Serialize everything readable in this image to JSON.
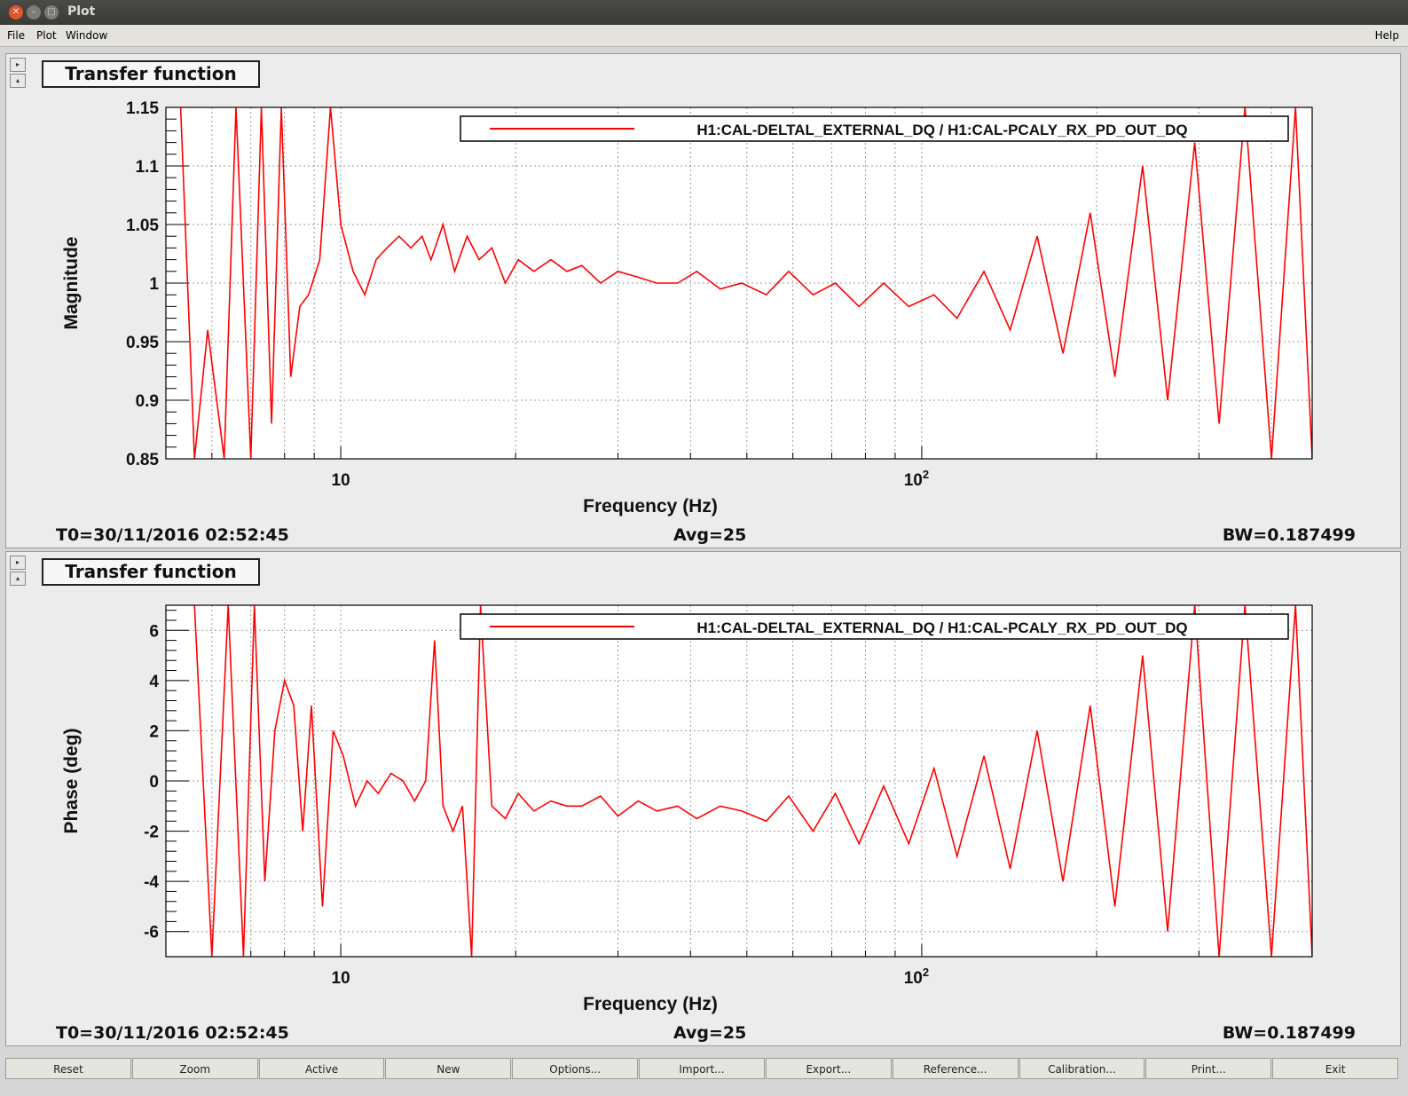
{
  "window": {
    "title": "Plot"
  },
  "menu": {
    "file": "File",
    "plot": "Plot",
    "window": "Window",
    "help": "Help"
  },
  "pads": [
    {
      "box_title": "Transfer function",
      "info": {
        "t0": "T0=30/11/2016 02:52:45",
        "avg": "Avg=25",
        "bw": "BW=0.187499"
      }
    },
    {
      "box_title": "Transfer function",
      "info": {
        "t0": "T0=30/11/2016 02:52:45",
        "avg": "Avg=25",
        "bw": "BW=0.187499"
      }
    }
  ],
  "toolbar": [
    "Reset",
    "Zoom",
    "Active",
    "New",
    "Options...",
    "Import...",
    "Export...",
    "Reference...",
    "Calibration...",
    "Print...",
    "Exit"
  ],
  "colors": {
    "trace": "#ff0000",
    "grid": "#999999"
  },
  "chart_data": [
    {
      "type": "line",
      "xlabel": "Frequency (Hz)",
      "ylabel": "Magnitude",
      "xscale": "log",
      "xlim": [
        5,
        470
      ],
      "ylim": [
        0.85,
        1.15
      ],
      "xticklabels": [
        "10",
        "10^2"
      ],
      "yticks": [
        0.85,
        0.9,
        0.95,
        1,
        1.05,
        1.1,
        1.15
      ],
      "yticklabels": [
        "0.85",
        "0.9",
        "0.95",
        "1",
        "1.05",
        "1.1",
        "1.15"
      ],
      "legend": "top-right",
      "grid": true,
      "series": [
        {
          "name": "H1:CAL-DELTAL_EXTERNAL_DQ / H1:CAL-PCALY_RX_PD_OUT_DQ",
          "x": [
            5.3,
            5.6,
            5.9,
            6.3,
            6.6,
            7.0,
            7.3,
            7.6,
            7.9,
            8.2,
            8.5,
            8.8,
            9.2,
            9.6,
            10.0,
            10.5,
            11.0,
            11.5,
            12.0,
            12.6,
            13.2,
            13.8,
            14.3,
            15.0,
            15.7,
            16.5,
            17.3,
            18.2,
            19.2,
            20.2,
            21.5,
            23,
            24.5,
            26,
            28,
            30,
            32.5,
            35,
            38,
            41,
            45,
            49,
            54,
            59,
            65,
            71,
            78,
            86,
            95,
            105,
            115,
            128,
            142,
            158,
            175,
            195,
            215,
            240,
            265,
            295,
            325,
            360,
            400,
            440,
            470
          ],
          "y": [
            1.15,
            0.85,
            0.96,
            0.85,
            1.15,
            0.85,
            1.15,
            0.88,
            1.15,
            0.92,
            0.98,
            0.99,
            1.02,
            1.15,
            1.05,
            1.01,
            0.99,
            1.02,
            1.03,
            1.04,
            1.03,
            1.04,
            1.02,
            1.05,
            1.01,
            1.04,
            1.02,
            1.03,
            1.0,
            1.02,
            1.01,
            1.02,
            1.01,
            1.015,
            1.0,
            1.01,
            1.005,
            1.0,
            1.0,
            1.01,
            0.995,
            1.0,
            0.99,
            1.01,
            0.99,
            1.0,
            0.98,
            1.0,
            0.98,
            0.99,
            0.97,
            1.01,
            0.96,
            1.04,
            0.94,
            1.06,
            0.92,
            1.1,
            0.9,
            1.12,
            0.88,
            1.15,
            0.85,
            1.15,
            0.85
          ]
        }
      ]
    },
    {
      "type": "line",
      "xlabel": "Frequency (Hz)",
      "ylabel": "Phase (deg)",
      "xscale": "log",
      "xlim": [
        5,
        470
      ],
      "ylim": [
        -7,
        7
      ],
      "xticklabels": [
        "10",
        "10^2"
      ],
      "yticks": [
        -6,
        -4,
        -2,
        0,
        2,
        4,
        6
      ],
      "yticklabels": [
        "-6",
        "-4",
        "-2",
        "0",
        "2",
        "4",
        "6"
      ],
      "legend": "top-right",
      "grid": true,
      "series": [
        {
          "name": "H1:CAL-DELTAL_EXTERNAL_DQ / H1:CAL-PCALY_RX_PD_OUT_DQ",
          "x": [
            5.6,
            6.0,
            6.4,
            6.8,
            7.1,
            7.4,
            7.7,
            8.0,
            8.3,
            8.6,
            8.9,
            9.3,
            9.7,
            10.1,
            10.6,
            11.1,
            11.6,
            12.2,
            12.8,
            13.4,
            14.0,
            14.5,
            15.0,
            15.6,
            16.2,
            16.8,
            17.4,
            18.2,
            19.2,
            20.2,
            21.5,
            23,
            24.5,
            26,
            28,
            30,
            32.5,
            35,
            38,
            41,
            45,
            49,
            54,
            59,
            65,
            71,
            78,
            86,
            95,
            105,
            115,
            128,
            142,
            158,
            175,
            195,
            215,
            240,
            265,
            295,
            325,
            360,
            400,
            440,
            470
          ],
          "y": [
            7,
            -7,
            7,
            -7,
            7,
            -4,
            2,
            4,
            3,
            -2,
            3,
            -5,
            2,
            1,
            -1,
            0,
            -0.5,
            0.3,
            0,
            -0.8,
            0,
            5.6,
            -1,
            -2,
            -1,
            -7,
            7,
            -1,
            -1.5,
            -0.5,
            -1.2,
            -0.8,
            -1,
            -1,
            -0.6,
            -1.4,
            -0.8,
            -1.2,
            -1,
            -1.5,
            -1,
            -1.2,
            -1.6,
            -0.6,
            -2,
            -0.5,
            -2.5,
            -0.2,
            -2.5,
            0.5,
            -3,
            1,
            -3.5,
            2,
            -4,
            3,
            -5,
            5,
            -6,
            7,
            -7,
            7,
            -7,
            7,
            -7
          ]
        }
      ]
    }
  ]
}
